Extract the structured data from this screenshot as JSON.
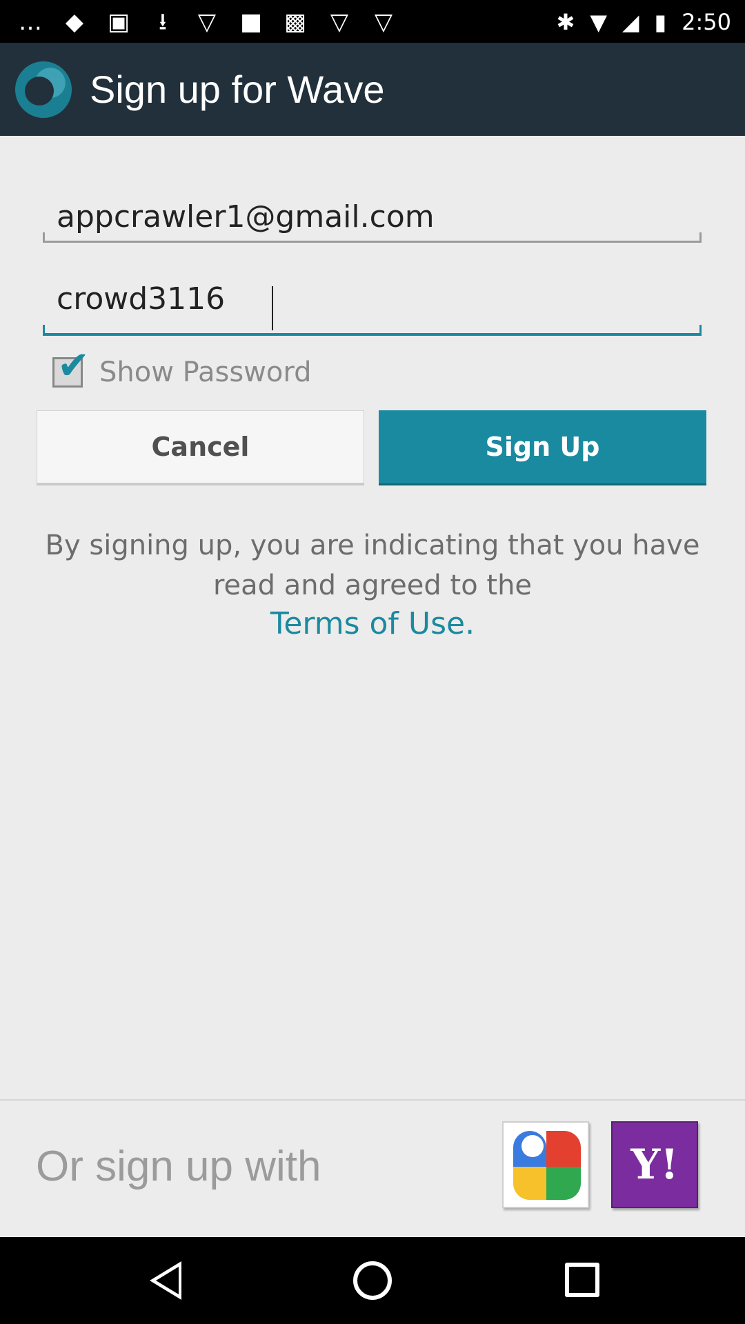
{
  "status_bar": {
    "time": "2:50",
    "left_icons": [
      "chat-icon",
      "shield-icon",
      "store-icon",
      "download-icon",
      "wifi-icon",
      "image-icon",
      "game-icon",
      "wifi-icon",
      "wifi-icon"
    ],
    "right_icons": [
      "bluetooth-icon",
      "wifi-icon",
      "signal-icon",
      "battery-icon"
    ]
  },
  "app_bar": {
    "title": "Sign up for Wave",
    "logo": "wave-logo"
  },
  "form": {
    "email_value": "appcrawler1@gmail.com",
    "password_value": "crowd3116",
    "show_password_label": "Show Password",
    "show_password_checked": true,
    "cancel_label": "Cancel",
    "signup_label": "Sign Up",
    "terms_text": "By signing up, you are indicating that you have read and agreed to the",
    "terms_link": "Terms of Use."
  },
  "alt_signup": {
    "label": "Or sign up with",
    "google_icon": "google-icon",
    "yahoo_label": "Y!"
  },
  "nav_bar": {
    "buttons": [
      "back-icon",
      "home-icon",
      "recent-apps-icon"
    ]
  },
  "colors": {
    "accent": "#1a8aa0",
    "app_bar": "#22303b",
    "background": "#ececec",
    "yahoo": "#7b2c9e"
  }
}
